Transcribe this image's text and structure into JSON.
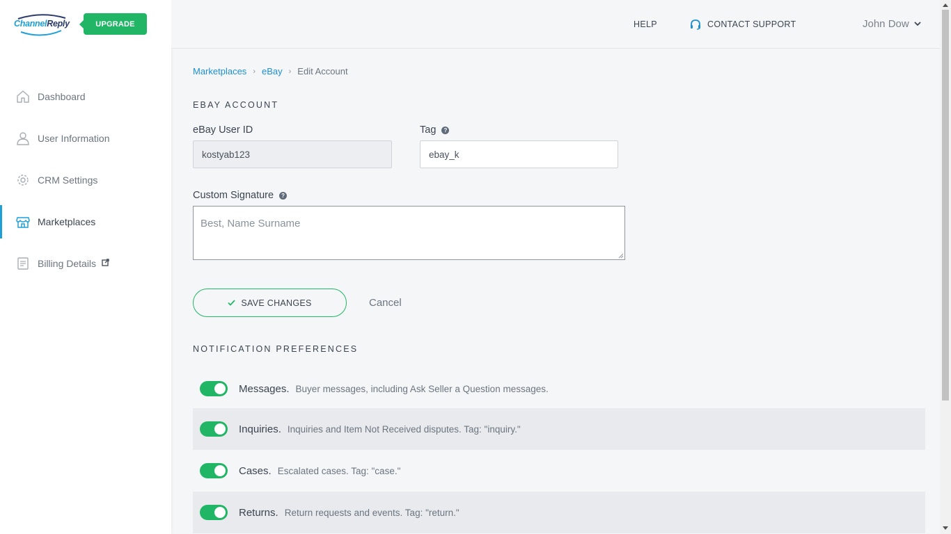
{
  "brand": {
    "logo_part1": "Channel",
    "logo_part2": "Reply",
    "upgrade_label": "UPGRADE"
  },
  "sidebar": {
    "items": [
      {
        "label": "Dashboard",
        "icon": "home-icon"
      },
      {
        "label": "User Information",
        "icon": "user-icon"
      },
      {
        "label": "CRM Settings",
        "icon": "gear-icon"
      },
      {
        "label": "Marketplaces",
        "icon": "store-icon",
        "active": true
      },
      {
        "label": "Billing Details",
        "icon": "billing-icon",
        "external": true
      }
    ]
  },
  "header": {
    "help": "HELP",
    "support": "CONTACT SUPPORT",
    "user_name": "John Dow"
  },
  "breadcrumb": {
    "items": [
      "Marketplaces",
      "eBay"
    ],
    "current": "Edit Account"
  },
  "account": {
    "section_title": "EBAY ACCOUNT",
    "user_id_label": "eBay User ID",
    "user_id_value": "kostyab123",
    "tag_label": "Tag",
    "tag_value": "ebay_k",
    "signature_label": "Custom Signature",
    "signature_placeholder": "Best, Name Surname"
  },
  "actions": {
    "save": "SAVE CHANGES",
    "cancel": "Cancel"
  },
  "notifications": {
    "section_title": "NOTIFICATION PREFERENCES",
    "items": [
      {
        "name": "Messages.",
        "desc": "Buyer messages, including Ask Seller a Question messages.",
        "enabled": true
      },
      {
        "name": "Inquiries.",
        "desc": "Inquiries and Item Not Received disputes. Tag: \"inquiry.\"",
        "enabled": true
      },
      {
        "name": "Cases.",
        "desc": "Escalated cases. Tag: \"case.\"",
        "enabled": true
      },
      {
        "name": "Returns.",
        "desc": "Return requests and events. Tag: \"return.\"",
        "enabled": true
      }
    ]
  },
  "colors": {
    "accent_green": "#21b665",
    "link_blue": "#1d8fd0"
  }
}
